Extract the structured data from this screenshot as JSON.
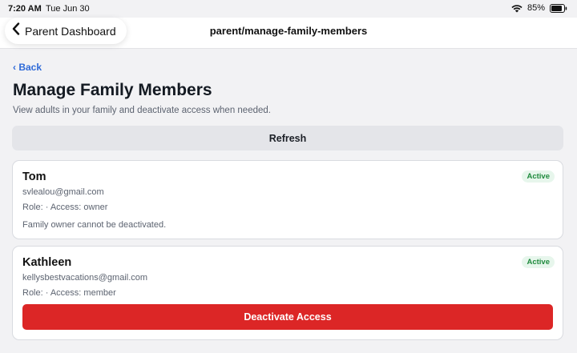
{
  "status_bar": {
    "time": "7:20 AM",
    "date": "Tue Jun 30",
    "battery": "85%"
  },
  "nav": {
    "back_label": "Parent Dashboard",
    "title": "parent/manage-family-members"
  },
  "page": {
    "back_link": "‹ Back",
    "title": "Manage Family Members",
    "subtitle": "View adults in your family and deactivate access when needed.",
    "refresh_label": "Refresh"
  },
  "members": [
    {
      "name": "Tom",
      "email": "svlealou@gmail.com",
      "role_line": "Role:  · Access: owner",
      "status": "Active",
      "note": "Family owner cannot be deactivated."
    },
    {
      "name": "Kathleen",
      "email": "kellysbestvacations@gmail.com",
      "role_line": "Role:  · Access: member",
      "status": "Active",
      "action_label": "Deactivate Access"
    }
  ],
  "colors": {
    "accent": "#2e6ad8",
    "danger": "#dc2626",
    "active_badge": "#1f8a3d"
  }
}
